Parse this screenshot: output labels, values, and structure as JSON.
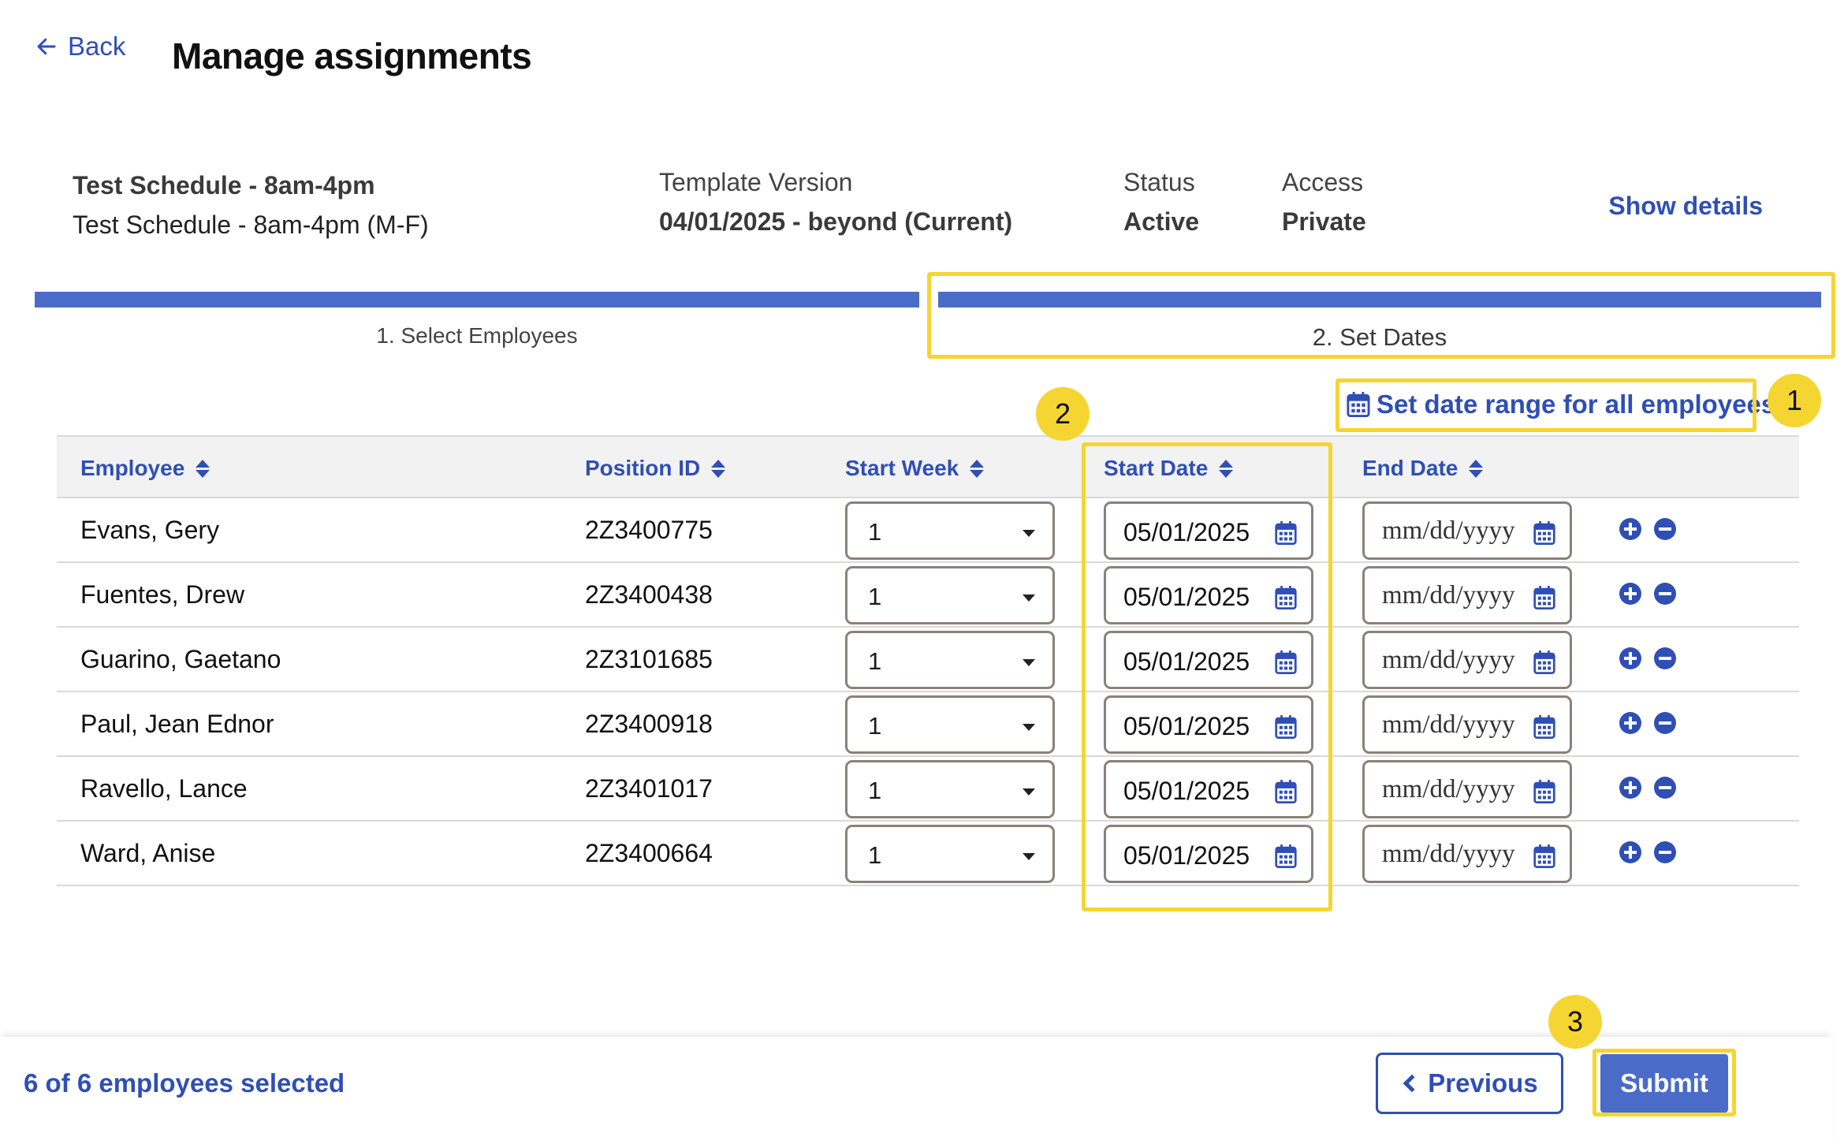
{
  "header": {
    "back_label": "Back",
    "title": "Manage assignments"
  },
  "summary": {
    "schedule_name": "Test Schedule - 8am-4pm",
    "schedule_subtitle": "Test Schedule - 8am-4pm (M-F)",
    "template_version_label": "Template Version",
    "template_version_value": "04/01/2025 - beyond (Current)",
    "status_label": "Status",
    "status_value": "Active",
    "access_label": "Access",
    "access_value": "Private",
    "show_details": "Show details"
  },
  "steps": [
    {
      "label": "1. Select Employees",
      "active": false
    },
    {
      "label": "2. Set Dates",
      "active": true
    }
  ],
  "range_link": "Set date range for all employees",
  "table": {
    "headers": {
      "employee": "Employee",
      "position": "Position ID",
      "start_week": "Start Week",
      "start_date": "Start Date",
      "end_date": "End Date"
    },
    "end_placeholder": "mm/dd/yyyy",
    "rows": [
      {
        "employee": "Evans, Gery",
        "position": "2Z3400775",
        "start_week": "1",
        "start_date": "05/01/2025"
      },
      {
        "employee": "Fuentes, Drew",
        "position": "2Z3400438",
        "start_week": "1",
        "start_date": "05/01/2025"
      },
      {
        "employee": "Guarino, Gaetano",
        "position": "2Z3101685",
        "start_week": "1",
        "start_date": "05/01/2025"
      },
      {
        "employee": "Paul, Jean Ednor",
        "position": "2Z3400918",
        "start_week": "1",
        "start_date": "05/01/2025"
      },
      {
        "employee": "Ravello, Lance",
        "position": "2Z3401017",
        "start_week": "1",
        "start_date": "05/01/2025"
      },
      {
        "employee": "Ward, Anise",
        "position": "2Z3400664",
        "start_week": "1",
        "start_date": "05/01/2025"
      }
    ]
  },
  "footer": {
    "selected_text": "6 of 6 employees selected",
    "previous_label": "Previous",
    "submit_label": "Submit"
  },
  "annotations": [
    "1",
    "2",
    "3"
  ],
  "colors": {
    "accent": "#2f4fb5",
    "step_bar": "#4a6cc8",
    "highlight": "#f5d531",
    "input_border": "#8a8178"
  },
  "icons": [
    "arrow-left-icon",
    "calendar-icon",
    "sort-icon",
    "chevron-down-icon",
    "plus-circle-icon",
    "minus-circle-icon",
    "chevron-left-icon"
  ]
}
